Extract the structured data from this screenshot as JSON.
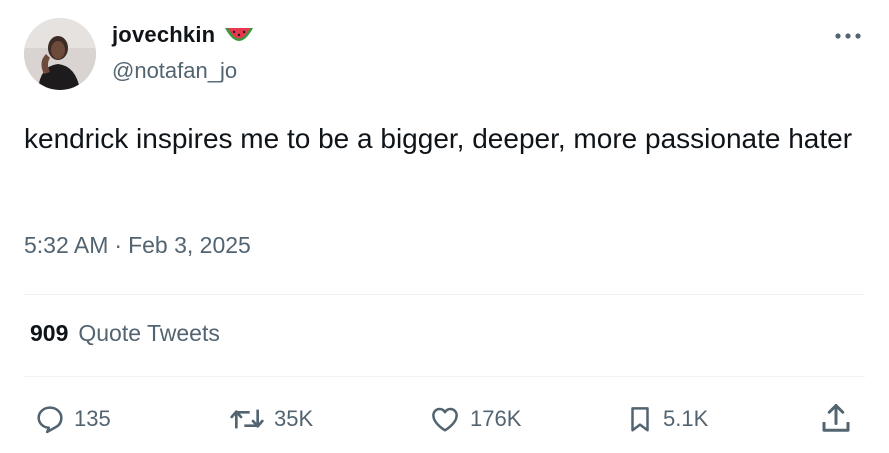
{
  "user": {
    "display_name": "jovechkin",
    "handle": "@notafan_jo",
    "name_emoji": "watermelon-icon"
  },
  "tweet": {
    "text": "kendrick inspires me to be a bigger, deeper, more passionate hater",
    "time": "5:32 AM",
    "separator": "·",
    "date": "Feb 3, 2025"
  },
  "quotes": {
    "count": "909",
    "label": "Quote Tweets"
  },
  "actions": {
    "replies": "135",
    "retweets": "35K",
    "likes": "176K",
    "bookmarks": "5.1K"
  },
  "icons": {
    "more": "more-icon",
    "reply": "reply-icon",
    "retweet": "retweet-icon",
    "like": "heart-icon",
    "bookmark": "bookmark-icon",
    "share": "share-icon"
  },
  "colors": {
    "text_primary": "#0f1419",
    "text_secondary": "#536471",
    "divider": "#eff3f4",
    "watermelon_rind": "#3a9a3e",
    "watermelon_flesh": "#e8384f"
  }
}
